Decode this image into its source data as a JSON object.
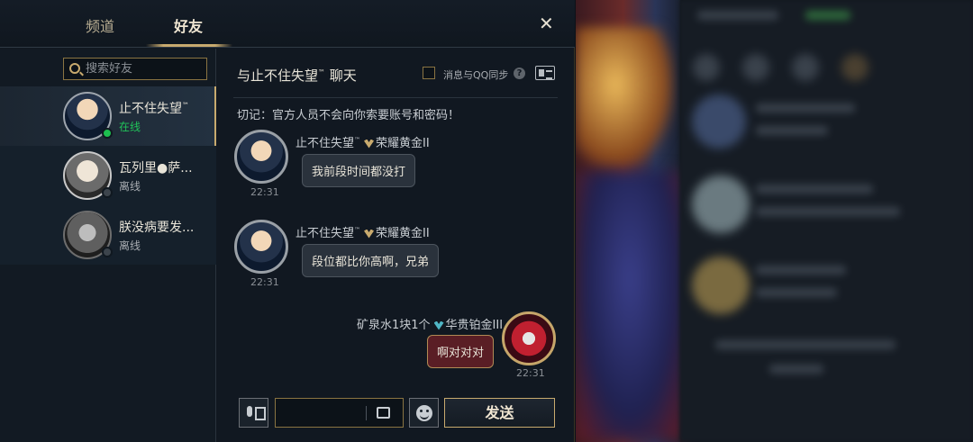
{
  "tabs": {
    "channels": "频道",
    "friends": "好友"
  },
  "search": {
    "placeholder": "搜索好友"
  },
  "friends": [
    {
      "name": "止不住失望",
      "name_badge": "™",
      "status": "在线",
      "online": true
    },
    {
      "name": "瓦列里●萨...",
      "status": "离线",
      "online": false
    },
    {
      "name": "朕没病要发...",
      "status": "离线",
      "online": false
    }
  ],
  "chat": {
    "title": "与止不住失望",
    "title_badge": "™",
    "title_suffix": "聊天",
    "sync_label": "消息与QQ同步",
    "help": "?",
    "warning": "切记：官方人员不会向你索要账号和密码！",
    "messages": [
      {
        "sender": "止不住失望",
        "sender_badge": "™",
        "rank": "荣耀黄金II",
        "text": "我前段时间都没打",
        "time": "22:31",
        "mine": false
      },
      {
        "sender": "止不住失望",
        "sender_badge": "™",
        "rank": "荣耀黄金II",
        "text": "段位都比你高啊，兄弟",
        "time": "22:31",
        "mine": false
      },
      {
        "sender": "矿泉水1块1个",
        "rank": "华贵铂金III",
        "text": "啊对对对",
        "time": "22:31",
        "mine": true
      }
    ],
    "send_label": "发送"
  },
  "icons": {
    "close": "close-icon",
    "search": "search-icon",
    "help": "help-icon",
    "profile_card": "profile-card-icon",
    "voice": "voice-icon",
    "expand": "expand-icon",
    "emoji": "emoji-icon",
    "rank_gold": "rank-gold-icon",
    "rank_plat": "rank-platinum-icon"
  },
  "colors": {
    "accent_gold": "#c8aa6e",
    "online": "#1dbf4f",
    "my_bubble": "#5a1e25"
  }
}
